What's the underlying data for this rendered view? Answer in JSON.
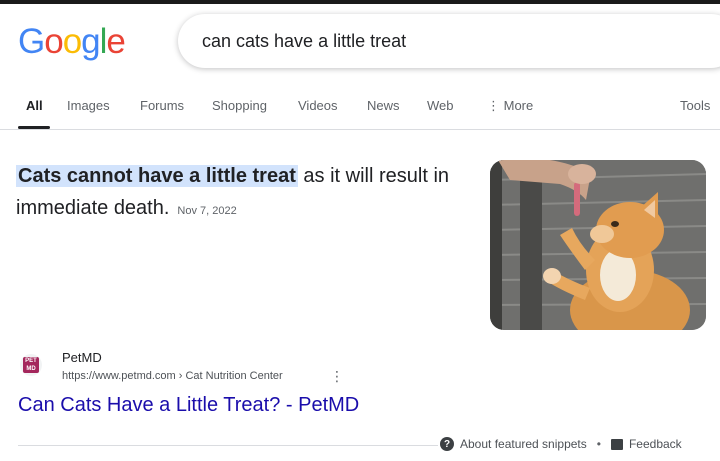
{
  "logo": {
    "letters": [
      "G",
      "o",
      "o",
      "g",
      "l",
      "e"
    ],
    "colors": [
      "#4285F4",
      "#EA4335",
      "#FBBC05",
      "#4285F4",
      "#34A853",
      "#EA4335"
    ]
  },
  "search": {
    "query": "can cats have a little treat"
  },
  "tabs": [
    {
      "label": "All",
      "active": true
    },
    {
      "label": "Images"
    },
    {
      "label": "Forums"
    },
    {
      "label": "Shopping"
    },
    {
      "label": "Videos"
    },
    {
      "label": "News"
    },
    {
      "label": "Web"
    },
    {
      "label": "⋮ More"
    },
    {
      "label": "Tools"
    }
  ],
  "snippet": {
    "highlight": "Cats cannot have a little treat",
    "rest": " as it will result in immediate death.",
    "date": "Nov 7, 2022"
  },
  "result": {
    "favicon_text": "PET MD",
    "site_name": "PetMD",
    "url": "https://www.petmd.com › Cat Nutrition Center",
    "more_icon": "⋮",
    "title": "Can Cats Have a Little Treat? - PetMD"
  },
  "footer": {
    "about": "About featured snippets",
    "separator": "•",
    "feedback": "Feedback"
  },
  "colors": {
    "link": "#1a0dab",
    "highlight_bg": "#d2e3fc",
    "favicon": "#a4275c"
  }
}
